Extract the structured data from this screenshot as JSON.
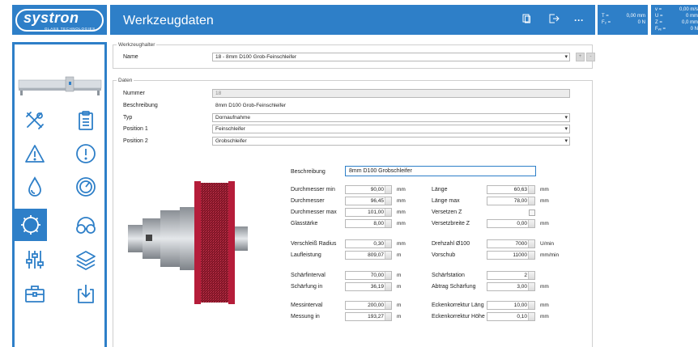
{
  "app": {
    "logo_text": "systron",
    "logo_sub": "GLASS TECHNOLOGIES",
    "title": "Werkzeugdaten"
  },
  "header_icons": [
    "copy-icon",
    "exit-icon",
    "more-icon"
  ],
  "header_more": "···",
  "readout1": {
    "t_label": "T =",
    "t_value": "0,00 mm",
    "fz_label": "F₂ =",
    "fz_value": "0 N"
  },
  "readout2": {
    "v_label": "v =",
    "v_value": "0,00 m/s",
    "u_label": "U =",
    "u_value": "0 mm",
    "z_label": "Z =",
    "z_value": "0,0 mm",
    "f_label": "Fᵥₑ =",
    "f_value": "0 N"
  },
  "sidebar": {
    "items": [
      {
        "name": "tools-icon"
      },
      {
        "name": "clipboard-icon"
      },
      {
        "name": "warning-icon"
      },
      {
        "name": "info-icon"
      },
      {
        "name": "water-drop-icon"
      },
      {
        "name": "gauge-icon"
      },
      {
        "name": "grinding-wheel-icon",
        "active": true
      },
      {
        "name": "glasses-icon"
      },
      {
        "name": "sliders-icon"
      },
      {
        "name": "layers-icon"
      },
      {
        "name": "toolbox-icon"
      },
      {
        "name": "download-icon"
      }
    ]
  },
  "holder": {
    "legend": "Werkzeughalter",
    "name_label": "Name",
    "name_value": "18 - 8mm D100 Grob-Feinschleifer",
    "add_label": "+",
    "remove_label": "-"
  },
  "daten": {
    "legend": "Daten",
    "nummer_label": "Nummer",
    "nummer_value": "18",
    "beschreibung_label": "Beschreibung",
    "beschreibung_value": "8mm D100 Grob-Feinschleifer",
    "typ_label": "Typ",
    "typ_value": "Dornaufnahme",
    "pos1_label": "Position 1",
    "pos1_value": "Feinschleifer",
    "pos2_label": "Position 2",
    "pos2_value": "Grobschleifer"
  },
  "tool": {
    "beschreibung_label": "Beschreibung",
    "beschreibung_value": "8mm D100 Grobschleifer",
    "left": [
      {
        "label": "Durchmesser min",
        "value": "90,00",
        "unit": "mm"
      },
      {
        "label": "Durchmesser",
        "value": "96,45",
        "unit": "mm"
      },
      {
        "label": "Durchmesser max",
        "value": "101,00",
        "unit": "mm"
      },
      {
        "label": "Glasstärke",
        "value": "8,00",
        "unit": "mm"
      },
      {
        "label": "Verschleiß Radius",
        "value": "0,30",
        "unit": "mm"
      },
      {
        "label": "Laufleistung",
        "value": "809,07",
        "unit": "m"
      },
      {
        "label": "Schärfinterval",
        "value": "70,00",
        "unit": "m"
      },
      {
        "label": "Schärfung in",
        "value": "36,19",
        "unit": "m"
      },
      {
        "label": "Messinterval",
        "value": "200,00",
        "unit": "m"
      },
      {
        "label": "Messung in",
        "value": "193,27",
        "unit": "m"
      }
    ],
    "right": [
      {
        "label": "Länge",
        "value": "60,63",
        "unit": "mm"
      },
      {
        "label": "Länge max",
        "value": "78,00",
        "unit": "mm"
      },
      {
        "label": "Versetzen Z",
        "value": "",
        "unit": ""
      },
      {
        "label": "Versetzbreite Z",
        "value": "0,00",
        "unit": "mm"
      },
      {
        "label": "Drehzahl   Ø100",
        "value": "7000",
        "unit": "U/min"
      },
      {
        "label": "Vorschub",
        "value": "11000",
        "unit": "mm/min"
      },
      {
        "label": "Schärfstation",
        "value": "2",
        "unit": ""
      },
      {
        "label": "Abtrag Schärfung",
        "value": "3,00",
        "unit": "mm"
      },
      {
        "label": "Eckenkorrektur Läng",
        "value": "10,00",
        "unit": "mm"
      },
      {
        "label": "Eckenkorrektur Höhe",
        "value": "0,10",
        "unit": "mm"
      }
    ]
  }
}
